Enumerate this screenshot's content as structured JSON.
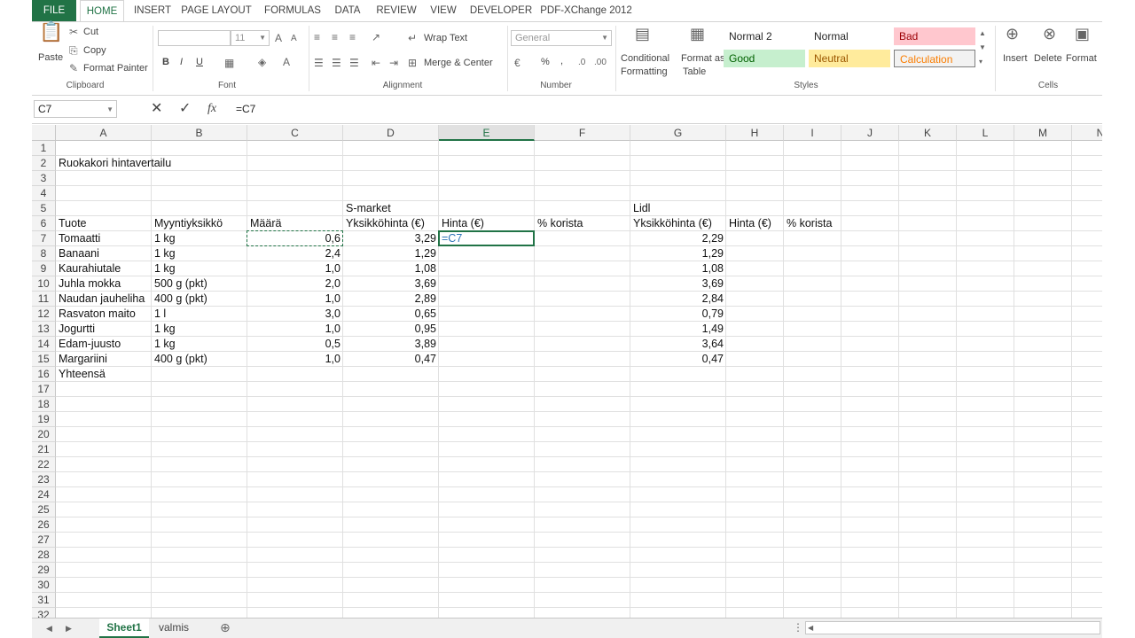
{
  "tabs": [
    "FILE",
    "HOME",
    "INSERT",
    "PAGE LAYOUT",
    "FORMULAS",
    "DATA",
    "REVIEW",
    "VIEW",
    "DEVELOPER",
    "PDF-XChange 2012"
  ],
  "ribbon": {
    "clipboard": {
      "paste": "Paste",
      "cut": "Cut",
      "copy": "Copy",
      "format_painter": "Format Painter",
      "label": "Clipboard"
    },
    "font": {
      "name": "",
      "size": "11",
      "bold": "B",
      "italic": "I",
      "underline": "U",
      "label": "Font"
    },
    "alignment": {
      "wrap_text": "Wrap Text",
      "merge_center": "Merge & Center",
      "label": "Alignment"
    },
    "number": {
      "format": "General",
      "percent": "%",
      "comma": ",",
      "label": "Number"
    },
    "styles_buttons": {
      "conditional": "Conditional",
      "formatting": "Formatting",
      "format_as": "Format as",
      "table": "Table",
      "label": "Styles"
    },
    "styles": [
      {
        "name": "Normal 2",
        "bg": "#ffffff",
        "fg": "#262626"
      },
      {
        "name": "Normal",
        "bg": "#ffffff",
        "fg": "#262626"
      },
      {
        "name": "Bad",
        "bg": "#ffc7ce",
        "fg": "#9c0006"
      },
      {
        "name": "Good",
        "bg": "#c6efce",
        "fg": "#006100"
      },
      {
        "name": "Neutral",
        "bg": "#ffeb9c",
        "fg": "#9c5700"
      },
      {
        "name": "Calculation",
        "bg": "#f2f2f2",
        "fg": "#fa7d00"
      }
    ],
    "cells": {
      "insert": "Insert",
      "delete": "Delete",
      "format": "Format",
      "label": "Cells"
    }
  },
  "formula_bar": {
    "name_box": "C7",
    "fx": "fx",
    "formula": "=C7"
  },
  "columns": [
    "A",
    "B",
    "C",
    "D",
    "E",
    "F",
    "G",
    "H",
    "I",
    "J",
    "K",
    "L",
    "M",
    "N"
  ],
  "rows": [
    "1",
    "2",
    "3",
    "4",
    "5",
    "6",
    "7",
    "8",
    "9",
    "10",
    "11",
    "12",
    "13",
    "14",
    "15",
    "16",
    "17",
    "18",
    "19",
    "20",
    "21",
    "22",
    "23",
    "24",
    "25",
    "26",
    "27",
    "28",
    "29",
    "30",
    "31",
    "32"
  ],
  "cells": {
    "A2": "Ruokakori hintavertailu",
    "D5": "S-market",
    "G5": "Lidl",
    "A6": "Tuote",
    "B6": "Myyntiyksikkö",
    "C6": "Määrä",
    "D6": "Yksikköhinta (€)",
    "E6": "Hinta (€)",
    "F6": "% korista",
    "G6": "Yksikköhinta (€)",
    "H6": "Hinta (€)",
    "I6": "% korista",
    "A7": "Tomaatti",
    "B7": "1 kg",
    "C7": "0,6",
    "D7": "3,29",
    "E7": "=C7",
    "G7": "2,29",
    "A8": "Banaani",
    "B8": "1 kg",
    "C8": "2,4",
    "D8": "1,29",
    "G8": "1,29",
    "A9": "Kaurahiutale",
    "B9": "1 kg",
    "C9": "1,0",
    "D9": "1,08",
    "G9": "1,08",
    "A10": "Juhla mokka",
    "B10": "500 g (pkt)",
    "C10": "2,0",
    "D10": "3,69",
    "G10": "3,69",
    "A11": "Naudan jauheliha",
    "B11": "400 g (pkt)",
    "C11": "1,0",
    "D11": "2,89",
    "G11": "2,84",
    "A12": "Rasvaton maito",
    "B12": "1 l",
    "C12": "3,0",
    "D12": "0,65",
    "G12": "0,79",
    "A13": "Jogurtti",
    "B13": "1 kg",
    "C13": "1,0",
    "D13": "0,95",
    "G13": "1,49",
    "A14": "Edam-juusto",
    "B14": "1 kg",
    "C14": "0,5",
    "D14": "3,89",
    "G14": "3,64",
    "A15": "Margariini",
    "B15": "400 g (pkt)",
    "C15": "1,0",
    "D15": "0,47",
    "G15": "0,47",
    "A16": "Yhteensä"
  },
  "sheets": [
    "Sheet1",
    "valmis"
  ],
  "active_sheet": "Sheet1",
  "active_cell": "E7",
  "copy_cell": "C7",
  "accent": "#217346"
}
